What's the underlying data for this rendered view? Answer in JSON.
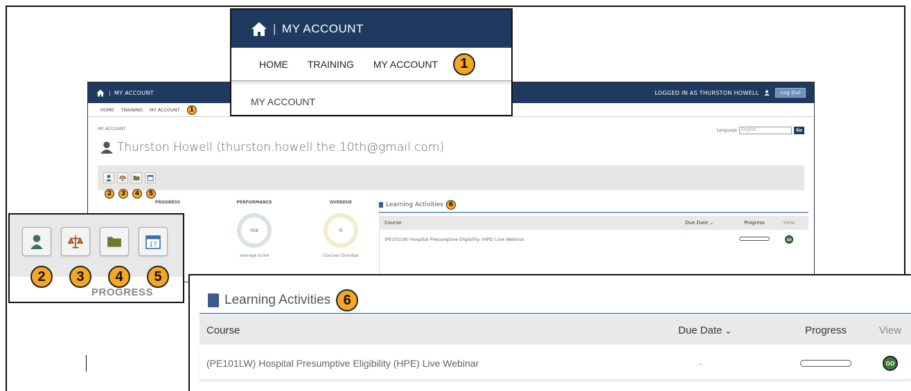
{
  "app": {
    "title": "MY ACCOUNT",
    "separator": "|",
    "logged_in_text": "LOGGED IN AS THURSTON HOWELL",
    "logout_label": "Log Out"
  },
  "nav": {
    "items": [
      "HOME",
      "TRAINING",
      "MY ACCOUNT"
    ],
    "sub_item": "MY ACCOUNT"
  },
  "breadcrumb": "MY ACCOUNT",
  "language": {
    "label": "Language",
    "selected": "English",
    "go_label": "Go"
  },
  "user": {
    "display": "Thurston Howell (thurston.howell.the.10th@gmail.com)"
  },
  "tools": [
    "person-icon",
    "scales-icon",
    "folder-icon",
    "calendar-icon"
  ],
  "calendar_day": "17",
  "badges": {
    "nav": "1",
    "tools": [
      "2",
      "3",
      "4",
      "5"
    ],
    "learning": "6"
  },
  "stats": {
    "progress_label": "PROGRESS",
    "performance_label": "PERFORMANCE",
    "performance_value": "n/a",
    "performance_caption": "average score",
    "overdue_label": "OVERDUE",
    "overdue_value": "0",
    "overdue_caption": "Courses Overdue"
  },
  "learning": {
    "title": "Learning Activities",
    "columns": {
      "course": "Course",
      "due_date": "Due Date",
      "progress": "Progress",
      "view": "View"
    },
    "rows": [
      {
        "course": "(PE101LW) Hospital Presumptive Eligibility (HPE) Live Webinar",
        "due_date": "-",
        "progress": 0,
        "view": "GO"
      }
    ]
  },
  "colors": {
    "header_bg": "#1e3a5f",
    "badge": "#f5a623",
    "rule": "#6fa0cf",
    "go_button": "#3a7a3a"
  }
}
